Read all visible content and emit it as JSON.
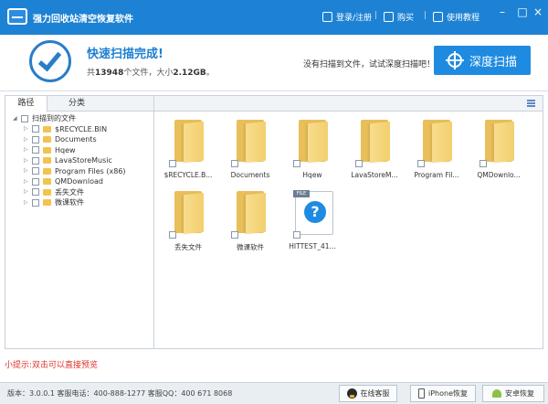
{
  "app": {
    "title": "强力回收站清空恢复软件"
  },
  "titlebar": {
    "login_label": "登录/注册",
    "buy_label": "购买",
    "tutorial_label": "使用教程",
    "separator": "|"
  },
  "banner": {
    "title": "快速扫描完成!",
    "stats_prefix": "共",
    "file_count": "13948",
    "stats_middle": "个文件，大小",
    "total_size": "2.12GB",
    "stats_suffix": "。",
    "deep_hint": "没有扫描到文件，试试深度扫描吧！",
    "deep_button": "深度扫描"
  },
  "left_tabs": [
    "路径",
    "分类"
  ],
  "tree": {
    "root": "扫描到的文件",
    "children": [
      "$RECYCLE.BIN",
      "Documents",
      "Hqew",
      "LavaStoreMusic",
      "Program Files (x86)",
      "QMDownload",
      "丢失文件",
      "微课软件"
    ]
  },
  "files": [
    {
      "label": "$RECYCLE.B...",
      "icon": "folder-icon"
    },
    {
      "label": "Documents",
      "icon": "folder-icon"
    },
    {
      "label": "Hqew",
      "icon": "folder-icon"
    },
    {
      "label": "LavaStoreM...",
      "icon": "folder-icon"
    },
    {
      "label": "Program Fil...",
      "icon": "folder-icon"
    },
    {
      "label": "QMDownlo...",
      "icon": "folder-icon"
    },
    {
      "label": "丢失文件",
      "icon": "folder-icon"
    },
    {
      "label": "微课软件",
      "icon": "folder-icon"
    },
    {
      "label": "HITTEST_41...",
      "icon": "unknown-file-icon",
      "tag": "FILE",
      "symbol": "?"
    }
  ],
  "hint": "小提示:双击可以直接预览",
  "status": {
    "text": "版本：3.0.0.1  客服电话：400-888-1277    客服QQ：400 671 8068",
    "online_service": "在线客服",
    "iphone_recovery": "iPhone恢复",
    "android_recovery": "安卓恢复"
  },
  "colors": {
    "accent": "#1e82d4",
    "hint": "#e0322a",
    "folder": "#f3cf6e"
  }
}
